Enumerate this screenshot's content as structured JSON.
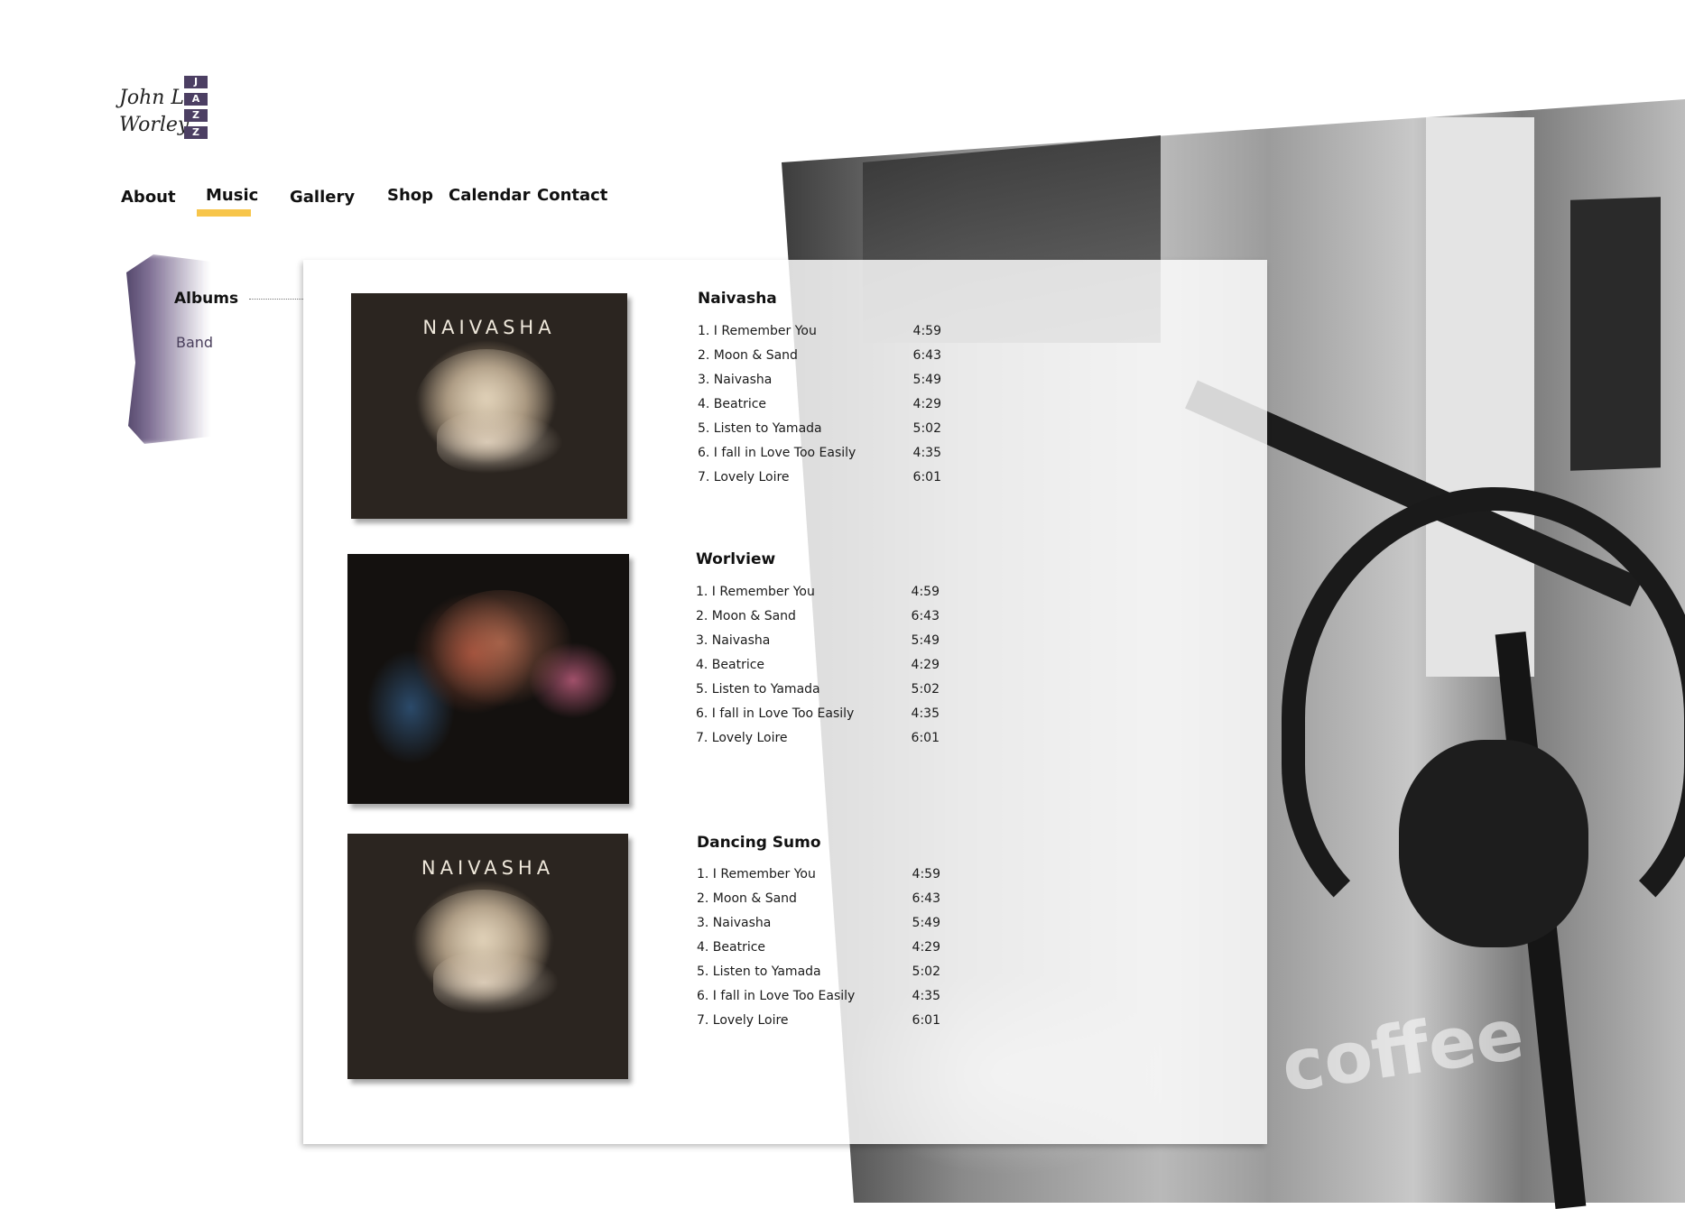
{
  "logo": {
    "line1": "John L.",
    "line2": "Worley",
    "vertical_text": "JAZZ",
    "accent_color": "#4c3f63"
  },
  "nav": {
    "items": [
      {
        "label": "About"
      },
      {
        "label": "Music",
        "active": true
      },
      {
        "label": "Gallery"
      },
      {
        "label": "Shop"
      },
      {
        "label": "Calendar"
      },
      {
        "label": "Contact"
      }
    ],
    "active_underline_color": "#f7c54a"
  },
  "subnav": {
    "items": [
      {
        "label": "Albums",
        "active": true
      },
      {
        "label": "Band"
      }
    ],
    "accent_color": "#4a3f5c"
  },
  "albums": [
    {
      "title": "Naivasha",
      "cover_text": "NAIVASHA",
      "tracks": [
        {
          "name": "1. I Remember You",
          "duration": "4:59"
        },
        {
          "name": "2. Moon & Sand",
          "duration": "6:43"
        },
        {
          "name": "3. Naivasha",
          "duration": "5:49"
        },
        {
          "name": "4. Beatrice",
          "duration": "4:29"
        },
        {
          "name": "5. Listen to Yamada",
          "duration": "5:02"
        },
        {
          "name": "6. I fall in Love Too Easily",
          "duration": "4:35"
        },
        {
          "name": "7. Lovely Loire",
          "duration": "6:01"
        }
      ]
    },
    {
      "title": "Worlview",
      "cover_text": "",
      "tracks": [
        {
          "name": "1. I Remember You",
          "duration": "4:59"
        },
        {
          "name": "2. Moon & Sand",
          "duration": "6:43"
        },
        {
          "name": "3. Naivasha",
          "duration": "5:49"
        },
        {
          "name": "4. Beatrice",
          "duration": "4:29"
        },
        {
          "name": "5. Listen to Yamada",
          "duration": "5:02"
        },
        {
          "name": "6. I fall in Love Too Easily",
          "duration": "4:35"
        },
        {
          "name": "7. Lovely Loire",
          "duration": "6:01"
        }
      ]
    },
    {
      "title": "Dancing Sumo",
      "cover_text": "NAIVASHA",
      "tracks": [
        {
          "name": "1. I Remember You",
          "duration": "4:59"
        },
        {
          "name": "2. Moon & Sand",
          "duration": "6:43"
        },
        {
          "name": "3. Naivasha",
          "duration": "5:49"
        },
        {
          "name": "4. Beatrice",
          "duration": "4:29"
        },
        {
          "name": "5. Listen to Yamada",
          "duration": "5:02"
        },
        {
          "name": "6. I fall in Love Too Easily",
          "duration": "4:35"
        },
        {
          "name": "7. Lovely Loire",
          "duration": "6:01"
        }
      ]
    }
  ],
  "background": {
    "sign_text": "coffee"
  }
}
